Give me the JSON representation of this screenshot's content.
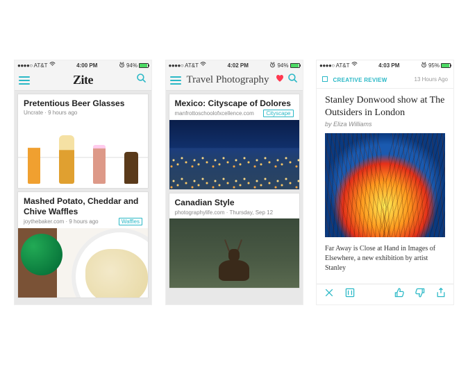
{
  "screen1": {
    "status": {
      "carrier_dots": "●●●●○",
      "carrier": "AT&T",
      "time": "4:00 PM",
      "alarm": true,
      "battery_pct": "94%"
    },
    "nav": {
      "title": "Zite"
    },
    "cards": [
      {
        "title": "Pretentious Beer Glasses",
        "source": "Uncrate",
        "time": "9 hours ago",
        "tag": ""
      },
      {
        "title": "Mashed Potato, Cheddar and Chive Waffles",
        "source": "joythebaker.com",
        "time": "9 hours ago",
        "tag": "Waffles"
      }
    ]
  },
  "screen2": {
    "status": {
      "carrier_dots": "●●●●○",
      "carrier": "AT&T",
      "time": "4:02 PM",
      "alarm": true,
      "battery_pct": "94%"
    },
    "nav": {
      "title": "Travel Photography"
    },
    "cards": [
      {
        "title": "Mexico: Cityscape of Dolores",
        "source": "manfrottoschoolofxcellence.com",
        "time": "",
        "tag": "Cityscape"
      },
      {
        "title": "Canadian Style",
        "source": "photographylife.com",
        "time": "Thursday, Sep 12",
        "tag": ""
      }
    ]
  },
  "screen3": {
    "status": {
      "carrier_dots": "●●●●○",
      "carrier": "AT&T",
      "time": "4:03 PM",
      "alarm": true,
      "battery_pct": "95%"
    },
    "source": "CREATIVE REVIEW",
    "ago": "13 Hours Ago",
    "title": "Stanley Donwood show at The Outsiders in London",
    "byline_prefix": "by ",
    "byline_author": "Eliza Williams",
    "excerpt": "Far Away is Close at Hand in Images of Elsewhere, a new exhibition by artist Stanley"
  }
}
